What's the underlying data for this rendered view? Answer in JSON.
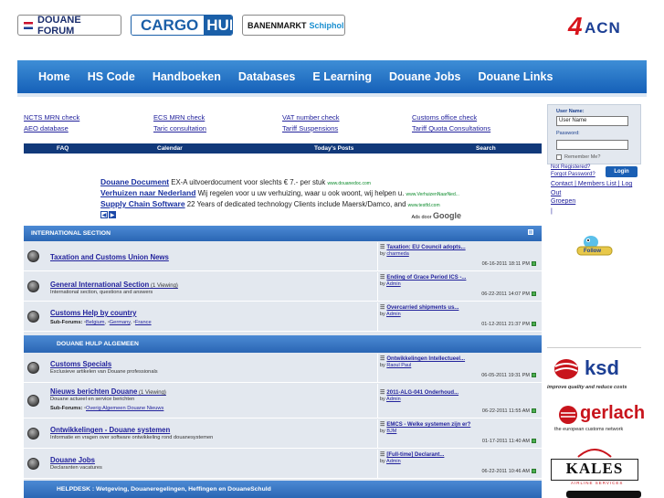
{
  "logos": {
    "douane_forum": "DOUANE FORUM",
    "cargo": "CARGO",
    "hub": "HUB",
    "banenmarkt": "BANENMARKT",
    "schiphol": "Schiphol",
    "acn_four": "4",
    "acn": "ACN"
  },
  "nav": [
    "Home",
    "HS Code",
    "Handboeken",
    "Databases",
    "E Learning",
    "Douane Jobs",
    "Douane Links"
  ],
  "quick_links": [
    [
      "NCTS MRN check",
      "AEO database"
    ],
    [
      "ECS MRN check",
      "Taric consultation"
    ],
    [
      "VAT number check",
      "Tariff Suspensions"
    ],
    [
      "Customs office check",
      "Tariff Quota Consultations"
    ]
  ],
  "subnav": [
    "FAQ",
    "Calendar",
    "Today's Posts",
    "Search"
  ],
  "ads": [
    {
      "title": "Douane Document",
      "text": " EX-A uitvoerdocument voor slechts € 7.- per stuk ",
      "url": "www.douanedoc.com"
    },
    {
      "title": "Verhuizen naar Nederland",
      "text": " Wij regelen voor u uw verhuizing, waar u ook woont, wij helpen u. ",
      "url": "www.VerhuizenNaarNed..."
    },
    {
      "title": "Supply Chain Software",
      "text": " 22 Years of dedicated technology Clients include Maersk/Damco, and ",
      "url": "www.testfd.com"
    }
  ],
  "ads_by": "Ads door",
  "ads_google": "Google",
  "sections": [
    {
      "title": "INTERNATIONAL SECTION"
    },
    {
      "title": "DOUANE HULP ALGEMEEN"
    },
    {
      "title": "HELPDESK : Wetgeving, Douaneregelingen, Heffingen en DouaneSchuld"
    }
  ],
  "forums": [
    {
      "title": "Taxation and Customs Union News",
      "viewing": "",
      "desc": "",
      "last_title": "Taxation: EU Council adopts...",
      "by": "by",
      "last_by": "charmeda",
      "date": "06-16-2011",
      "time": "18:11 PM"
    },
    {
      "title": "General International Section",
      "viewing": " (1 Viewing)",
      "desc": "International section, questions and answers",
      "last_title": "Ending of Grace Period ICS -...",
      "by": "by",
      "last_by": "Admin",
      "date": "06-22-2011",
      "time": "14:07 PM"
    },
    {
      "title": "Customs Help by country",
      "viewing": "",
      "desc": "",
      "sub_label": "Sub-Forums:",
      "subs": [
        "Belgium",
        "Germany",
        "France"
      ],
      "last_title": "Overcarried shipments us...",
      "by": "by",
      "last_by": "Admin",
      "date": "01-12-2011",
      "time": "21:37 PM"
    },
    {
      "title": "Customs Specials",
      "viewing": "",
      "desc": "Exclusieve artikelen van Douane professionals",
      "last_title": "Ontwikkelingen Intellectueel...",
      "by": "by",
      "last_by": "Raoul Paul",
      "date": "06-05-2011",
      "time": "19:31 PM"
    },
    {
      "title": "Nieuws berichten Douane",
      "viewing": " (1 Viewing)",
      "desc": "Douane actueel en service berichten",
      "sub_label": "Sub-Forums:",
      "subs": [
        "Overig Algemeen Douane Nieuws"
      ],
      "last_title": "2011-ALG-041 Onderhoud...",
      "by": "by",
      "last_by": "Admin",
      "date": "06-22-2011",
      "time": "11:55 AM"
    },
    {
      "title": "Ontwikkelingen - Douane systemen",
      "viewing": "",
      "desc": "Informatie en vragen over software ontwikkeling rond douanesystemen",
      "last_title": "EMCS - Welke systemen zijn er?",
      "by": "by",
      "last_by": "BJM",
      "date": "01-17-2011",
      "time": "11:40 AM"
    },
    {
      "title": "Douane Jobs",
      "viewing": "",
      "desc": "Declaranten vacatures",
      "last_title": "[Full-time] Declarant...",
      "by": "by",
      "last_by": "Admin",
      "date": "06-22-2011",
      "time": "10:46 AM"
    }
  ],
  "login": {
    "username_label": "User Name:",
    "username_value": "User Name",
    "password_label": "Password:",
    "remember": "Remember Me?",
    "not_registered": "Not Registered?",
    "forgot": "Forgot Password?",
    "button": "Login",
    "links": "Contact | Members List | Log Out",
    "groepen": "Groepen",
    "pipe": "|"
  },
  "follow": "Follow",
  "sponsors": {
    "ksd": "ksd",
    "ksd_tag": "improve quality and reduce costs",
    "gerlach": "gerlach",
    "gerlach_tag": "the european customs network",
    "kales": "KALES",
    "kales_tag": "AIRLINE SERVICES"
  }
}
